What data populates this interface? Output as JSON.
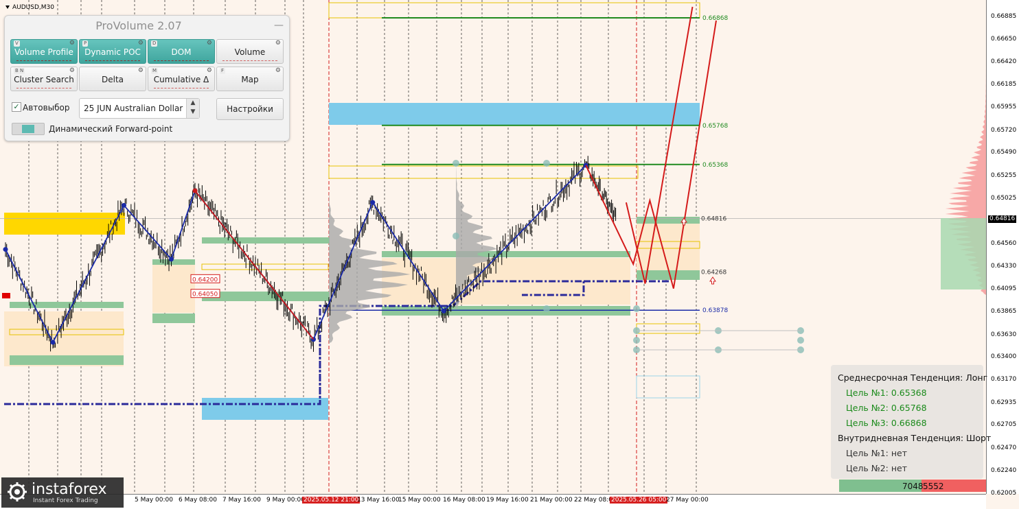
{
  "symbol": "AUDUSD,M30",
  "panel": {
    "title": "ProVolume 2.07",
    "minimize": "—",
    "buttons": [
      {
        "hotkey": "V",
        "label": "Volume Profile",
        "active": true
      },
      {
        "hotkey": "P",
        "label": "Dynamic POC",
        "active": true
      },
      {
        "hotkey": "D",
        "label": "DOM",
        "active": true
      },
      {
        "hotkey": "",
        "label": "Volume",
        "active": false
      },
      {
        "hotkey": "B N",
        "label": "Cluster Search",
        "active": false
      },
      {
        "hotkey": "",
        "label": "Delta",
        "active": false
      },
      {
        "hotkey": "M",
        "label": "Cumulative Δ",
        "active": false
      },
      {
        "hotkey": "F",
        "label": "Map",
        "active": false
      }
    ],
    "auto_label": "Автовыбор",
    "instrument": "25 JUN Australian Dollar",
    "settings_label": "Настройки",
    "forward_label": "Динамический Forward-point"
  },
  "info": {
    "medium_trend": "Среднесрочная Тенденция: Лонг",
    "targets_long": [
      "Цель №1: 0.65368",
      "Цель №2: 0.65768",
      "Цель №3: 0.66868"
    ],
    "intraday_trend": "Внутридневная Тенденция: Шорт",
    "targets_short": [
      "Цель №1: нет",
      "Цель №2: нет"
    ],
    "buy_volume": "7048",
    "sell_volume": "5552"
  },
  "logo": {
    "name": "instaforex",
    "tagline": "Instant Forex Trading"
  },
  "colors": {
    "background": "#fdf4ec",
    "candles": "#000000",
    "support_zone": "#8fc79a",
    "resistance_zone": "#ffd700",
    "target_line": "#1f8a1f",
    "zigzag": "#1a2aa8",
    "forecast": "#d41a1a",
    "cyan_zone": "#7ecbea"
  },
  "chart_data": {
    "type": "line",
    "title": "",
    "ylabel": "",
    "ylim": [
      0.62,
      0.6705
    ],
    "y_ticks": [
      "0.66885",
      "0.66650",
      "0.66420",
      "0.66185",
      "0.65955",
      "0.65720",
      "0.65490",
      "0.65255",
      "0.65025",
      "0.64816",
      "0.64560",
      "0.64330",
      "0.64095",
      "0.63865",
      "0.63630",
      "0.63400",
      "0.63170",
      "0.62935",
      "0.62705",
      "0.62470",
      "0.62240",
      "0.62005"
    ],
    "current_price": "0.64816",
    "x_labels": [
      "5 May 00:00",
      "6 May 08:00",
      "7 May 16:00",
      "9 May 00:00",
      "2025.05.12 21:00",
      "13 May 16:00",
      "15 May 00:00",
      "16 May 08:00",
      "19 May 16:00",
      "21 May 00:00",
      "22 May 08:00",
      "2025.05.26 05:00",
      "27 May 00:00"
    ],
    "levels": [
      {
        "name": "target-3",
        "value": 0.66868,
        "label": "0.66868"
      },
      {
        "name": "target-2",
        "value": 0.65768,
        "label": "0.65768"
      },
      {
        "name": "target-1",
        "value": 0.65368,
        "label": "0.65368"
      },
      {
        "name": "pivot",
        "value": 0.64816,
        "label": "0.64816"
      },
      {
        "name": "support-1",
        "value": 0.64268,
        "label": "0.64268"
      },
      {
        "name": "support-2",
        "value": 0.63878,
        "label": "0.63878"
      },
      {
        "name": "box-1",
        "value": 0.642,
        "label": "0.64200"
      },
      {
        "name": "box-2",
        "value": 0.6405,
        "label": "0.64050"
      }
    ],
    "zigzag": [
      {
        "t": 0,
        "p": 0.645
      },
      {
        "t": 2,
        "p": 0.6355
      },
      {
        "t": 5,
        "p": 0.6495
      },
      {
        "t": 7,
        "p": 0.644
      },
      {
        "t": 8,
        "p": 0.651
      },
      {
        "t": 13,
        "p": 0.6358
      },
      {
        "t": 15.5,
        "p": 0.6498
      },
      {
        "t": 18.5,
        "p": 0.6387
      },
      {
        "t": 24.5,
        "p": 0.6536
      }
    ],
    "forecast": [
      {
        "t": 24.5,
        "p": 0.6536
      },
      {
        "t": 26.5,
        "p": 0.6435
      },
      {
        "t": 27.2,
        "p": 0.65
      },
      {
        "t": 28.2,
        "p": 0.641
      },
      {
        "t": 30.0,
        "p": 0.6684
      }
    ],
    "forecast_alt": [
      {
        "t": 26.2,
        "p": 0.6498
      },
      {
        "t": 27.0,
        "p": 0.6415
      },
      {
        "t": 29.0,
        "p": 0.6698
      }
    ]
  }
}
